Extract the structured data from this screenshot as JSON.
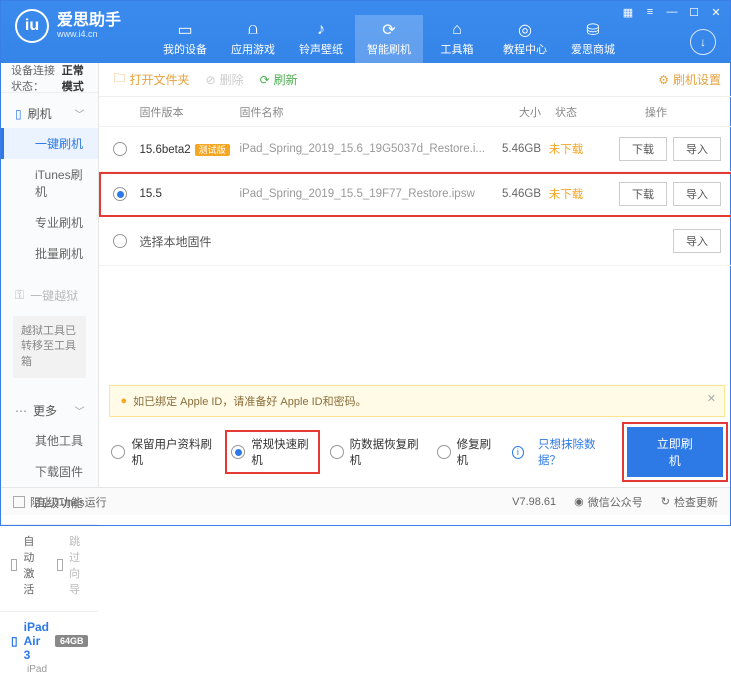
{
  "app": {
    "name_cn": "爱思助手",
    "name_en": "www.i4.cn"
  },
  "nav": {
    "items": [
      {
        "label": "我的设备"
      },
      {
        "label": "应用游戏"
      },
      {
        "label": "铃声壁纸"
      },
      {
        "label": "智能刷机"
      },
      {
        "label": "工具箱"
      },
      {
        "label": "教程中心"
      },
      {
        "label": "爱思商城"
      }
    ]
  },
  "sidebar": {
    "conn_label": "设备连接状态：",
    "conn_value": "正常模式",
    "grp_flash": "刷机",
    "items": [
      "一键刷机",
      "iTunes刷机",
      "专业刷机",
      "批量刷机"
    ],
    "grp_jail": "一键越狱",
    "jail_note": "越狱工具已转移至工具箱",
    "grp_more": "更多",
    "more_items": [
      "其他工具",
      "下载固件",
      "高级功能"
    ],
    "auto_act": "自动激活",
    "skip_guide": "跳过向导",
    "device": {
      "name": "iPad Air 3",
      "storage": "64GB",
      "type": "iPad"
    }
  },
  "toolbar": {
    "open": "打开文件夹",
    "del": "删除",
    "refresh": "刷新",
    "settings": "刷机设置"
  },
  "thead": {
    "ver": "固件版本",
    "name": "固件名称",
    "size": "大小",
    "stat": "状态",
    "op": "操作"
  },
  "rows": [
    {
      "ver": "15.6beta2",
      "beta": "测试版",
      "name": "iPad_Spring_2019_15.6_19G5037d_Restore.i...",
      "size": "5.46GB",
      "stat": "未下载"
    },
    {
      "ver": "15.5",
      "beta": "",
      "name": "iPad_Spring_2019_15.5_19F77_Restore.ipsw",
      "size": "5.46GB",
      "stat": "未下载"
    }
  ],
  "local_fw": "选择本地固件",
  "btn": {
    "download": "下载",
    "import": "导入"
  },
  "warn": "如已绑定 Apple ID，请准备好 Apple ID和密码。",
  "opts": {
    "a": "保留用户资料刷机",
    "b": "常规快速刷机",
    "c": "防数据恢复刷机",
    "d": "修复刷机",
    "link": "只想抹除数据？",
    "go": "立即刷机"
  },
  "status": {
    "block": "阻止iTunes运行",
    "ver": "V7.98.61",
    "wx": "微信公众号",
    "upd": "检查更新"
  }
}
